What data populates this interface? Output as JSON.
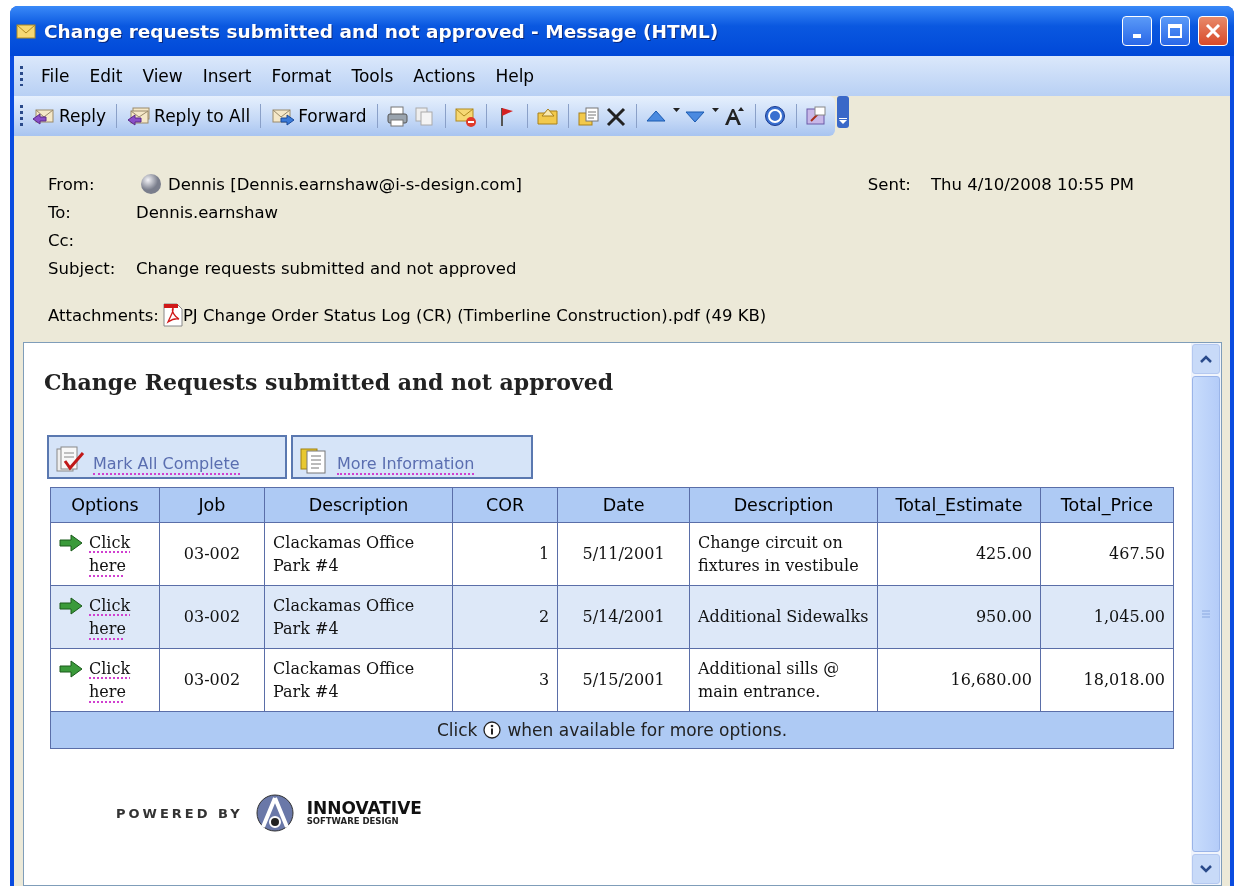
{
  "window": {
    "title": "Change requests submitted and not approved - Message (HTML)"
  },
  "menu": [
    {
      "label": "File"
    },
    {
      "label": "Edit"
    },
    {
      "label": "View"
    },
    {
      "label": "Insert"
    },
    {
      "label": "Format"
    },
    {
      "label": "Tools"
    },
    {
      "label": "Actions"
    },
    {
      "label": "Help"
    }
  ],
  "toolbar": {
    "buttons": [
      {
        "label": "Reply"
      },
      {
        "label": "Reply to All"
      },
      {
        "label": "Forward"
      }
    ]
  },
  "header": {
    "from": {
      "label": "From:",
      "value": "Dennis [Dennis.earnshaw@i-s-design.com]"
    },
    "sent": {
      "label": "Sent:",
      "value": "Thu 4/10/2008 10:55 PM"
    },
    "to": {
      "label": "To:",
      "value": "Dennis.earnshaw"
    },
    "cc": {
      "label": "Cc:"
    },
    "subject": {
      "label": "Subject:",
      "value": "Change requests submitted and not approved"
    },
    "attachments": {
      "label": "Attachments:",
      "value": "PJ Change Order Status Log (CR) (Timberline Construction).pdf (49 KB)"
    }
  },
  "body": {
    "heading": "Change Requests submitted and not approved",
    "actions": [
      {
        "label": "Mark All Complete"
      },
      {
        "label": "More Information"
      }
    ],
    "table": {
      "columns": [
        "Options",
        "Job",
        "Description",
        "COR",
        "Date",
        "Description",
        "Total_Estimate",
        "Total_Price"
      ],
      "rows": [
        {
          "cells": [
            "Click here",
            "03-002",
            "Clackamas Office Park #4",
            "1",
            "5/11/2001",
            "Change circuit on fixtures in vestibule",
            "425.00",
            "467.50"
          ]
        },
        {
          "cells": [
            "Click here",
            "03-002",
            "Clackamas Office Park #4",
            "2",
            "5/14/2001",
            "Additional Sidewalks",
            "950.00",
            "1,045.00"
          ]
        },
        {
          "cells": [
            "Click here",
            "03-002",
            "Clackamas Office Park #4",
            "3",
            "5/15/2001",
            "Additional sills @ main entrance.",
            "16,680.00",
            "18,018.00"
          ]
        }
      ],
      "footer": {
        "before": "Click",
        "after": "when available for more options."
      }
    },
    "powered_by": {
      "label": "POWERED BY",
      "brand": "INNOVATIVE",
      "tagline": "SOFTWARE DESIGN"
    }
  }
}
